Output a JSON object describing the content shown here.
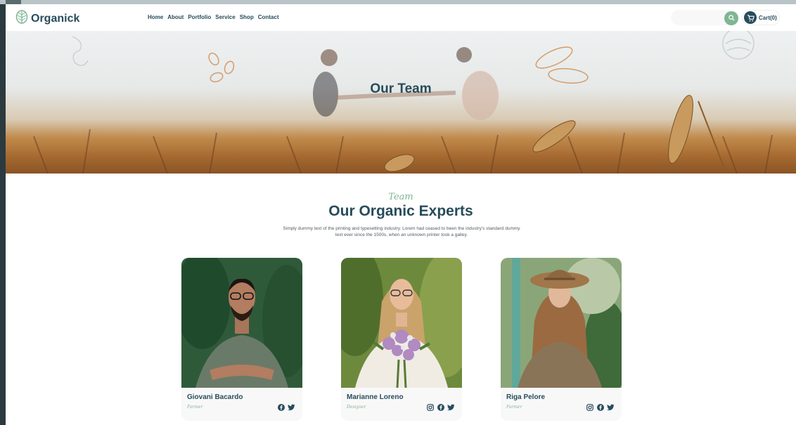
{
  "header": {
    "logo_text": "Organick",
    "nav": [
      "Home",
      "About",
      "Portfolio",
      "Service",
      "Shop",
      "Contact"
    ],
    "search_placeholder": "",
    "cart_label": "Cart(0)"
  },
  "hero": {
    "title": "Our Team"
  },
  "section": {
    "subtitle": "Team",
    "heading": "Our Organic Experts",
    "description": "Simply dummy text of the printing and typesetting industry. Lorem had ceased to been the industry's standard dummy text ever since the 1500s, when an unknown printer took a galley."
  },
  "team": [
    {
      "name": "Giovani Bacardo",
      "role": "Farmer",
      "socials": [
        "facebook-icon",
        "twitter-icon"
      ]
    },
    {
      "name": "Marianne Loreno",
      "role": "Designer",
      "socials": [
        "instagram-icon",
        "facebook-icon",
        "twitter-icon"
      ]
    },
    {
      "name": "Riga Pelore",
      "role": "Farmer",
      "socials": [
        "instagram-icon",
        "facebook-icon",
        "twitter-icon"
      ]
    }
  ],
  "colors": {
    "primary": "#274c5b",
    "accent": "#7eb693",
    "card_bg": "#f9f8f8"
  }
}
